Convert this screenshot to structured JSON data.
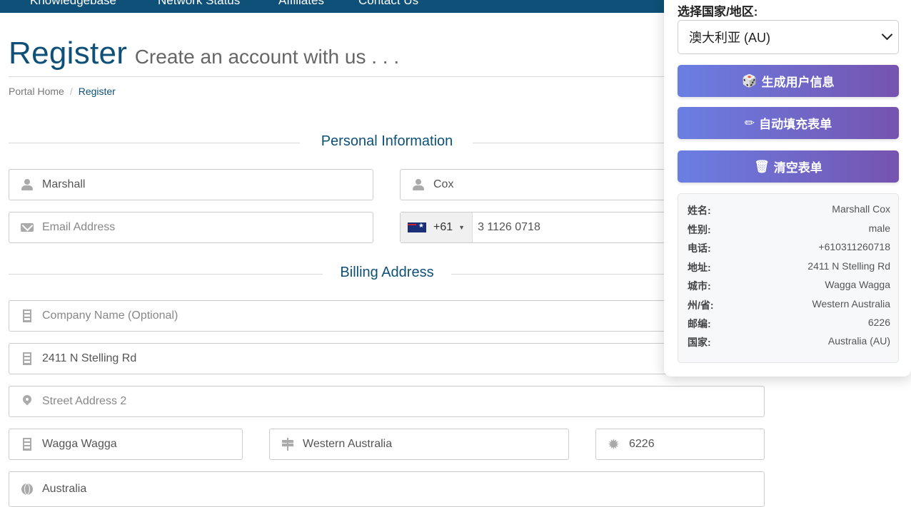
{
  "nav": {
    "items": [
      "Knowledgebase",
      "Network Status",
      "Affiliates",
      "Contact Us"
    ]
  },
  "header": {
    "title": "Register",
    "subtitle": "Create an account with us . . ."
  },
  "breadcrumb": {
    "home": "Portal Home",
    "separator": "/",
    "current": "Register"
  },
  "personal": {
    "heading": "Personal Information",
    "first_name": "Marshall",
    "last_name": "Cox",
    "email_placeholder": "Email Address",
    "phone_code": "+61",
    "phone_number": "3 1126 0718"
  },
  "billing": {
    "heading": "Billing Address",
    "company_placeholder": "Company Name (Optional)",
    "street1": "2411 N Stelling Rd",
    "street2_placeholder": "Street Address 2",
    "city": "Wagga Wagga",
    "state": "Western Australia",
    "postcode": "6226",
    "country": "Australia"
  },
  "panel": {
    "country_label": "选择国家/地区:",
    "country_selected": "澳大利亚 (AU)",
    "buttons": {
      "generate": "生成用户信息",
      "autofill": "自动填充表单",
      "clear": "清空表单"
    },
    "button_icons": {
      "generate": "dice-icon",
      "autofill": "pencil-icon",
      "clear": "trash-icon"
    },
    "info": [
      {
        "key": "姓名:",
        "value": "Marshall Cox"
      },
      {
        "key": "性别:",
        "value": "male"
      },
      {
        "key": "电话:",
        "value": "+610311260718"
      },
      {
        "key": "地址:",
        "value": "2411 N Stelling Rd"
      },
      {
        "key": "城市:",
        "value": "Wagga Wagga"
      },
      {
        "key": "州/省:",
        "value": "Western Australia"
      },
      {
        "key": "邮编:",
        "value": "6226"
      },
      {
        "key": "国家:",
        "value": "Australia (AU)"
      }
    ]
  },
  "colors": {
    "brand": "#0e5077",
    "button_gradient_start": "#6a7fe3",
    "button_gradient_end": "#7653b0"
  }
}
